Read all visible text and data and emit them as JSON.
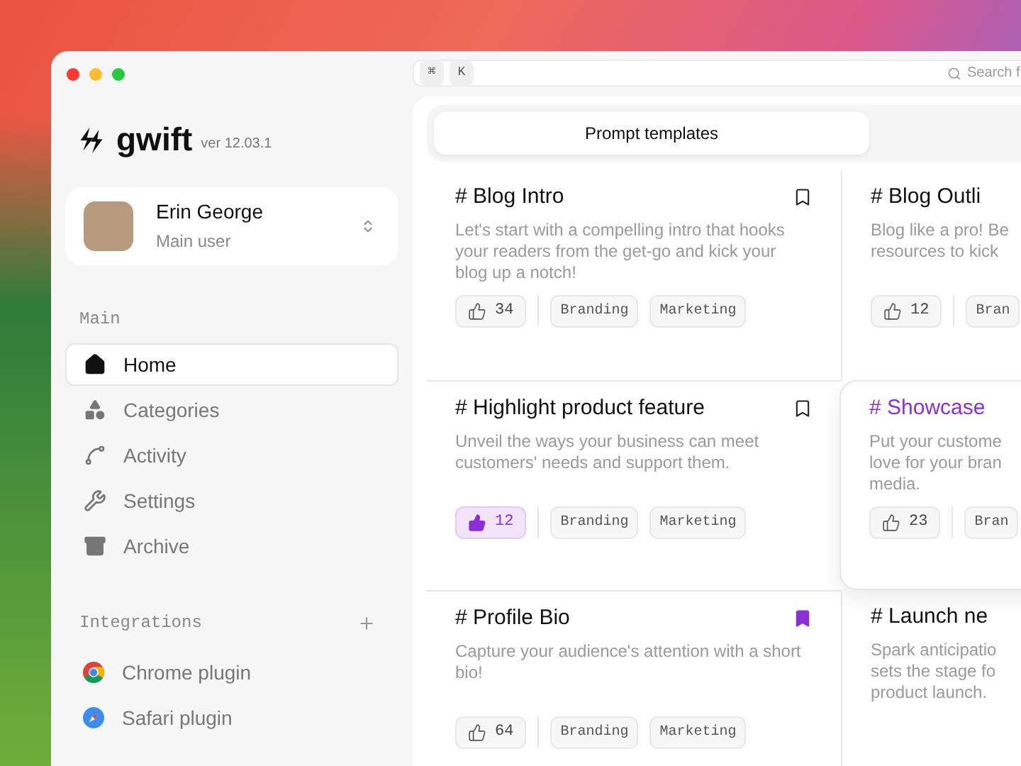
{
  "brand": {
    "name": "gwift",
    "version": "ver 12.03.1"
  },
  "user": {
    "name": "Erin George",
    "role": "Main user"
  },
  "sidebar": {
    "main_heading": "Main",
    "items": [
      {
        "label": "Home",
        "selected": true
      },
      {
        "label": "Categories",
        "selected": false
      },
      {
        "label": "Activity",
        "selected": false
      },
      {
        "label": "Settings",
        "selected": false
      },
      {
        "label": "Archive",
        "selected": false
      }
    ],
    "integrations_heading": "Integrations",
    "integrations": [
      {
        "label": "Chrome plugin"
      },
      {
        "label": "Safari plugin"
      }
    ]
  },
  "toolbar": {
    "keys": [
      "⌘",
      "K"
    ],
    "search": {
      "placeholder": "Search f"
    }
  },
  "tabs": [
    {
      "label": "Prompt templates",
      "selected": true
    }
  ],
  "templates": [
    {
      "prefix": "#",
      "title": "Blog Intro",
      "description_lines": [
        "Let's start with a compelling intro that hooks your readers from the get-go and kick your blog up a notch!"
      ],
      "likes": "34",
      "liked": false,
      "bookmarked": false,
      "tags": [
        "Branding",
        "Marketing"
      ]
    },
    {
      "prefix": "#",
      "title": "Blog Outli",
      "description_lines": [
        "Blog like a pro! Be",
        "resources to kick"
      ],
      "likes": "12",
      "liked": false,
      "tags": [
        "Bran"
      ]
    },
    {
      "prefix": "#",
      "title": "Highlight product feature",
      "description_lines": [
        "Unveil the ways your business can meet customers' needs and support them."
      ],
      "likes": "12",
      "liked": true,
      "bookmarked": false,
      "tags": [
        "Branding",
        "Marketing"
      ]
    },
    {
      "prefix": "#",
      "title": "Showcase",
      "description_lines": [
        "Put your custome",
        "love for your bran",
        "media."
      ],
      "likes": "23",
      "liked": false,
      "hovered": true,
      "tags": [
        "Bran"
      ]
    },
    {
      "prefix": "#",
      "title": "Profile Bio",
      "description_lines": [
        "Capture your audience's attention with a short bio!"
      ],
      "likes": "64",
      "liked": false,
      "bookmarked": true,
      "tags": [
        "Branding",
        "Marketing"
      ]
    },
    {
      "prefix": "#",
      "title": "Launch ne",
      "description_lines": [
        "Spark anticipatio",
        "sets the stage fo",
        "product launch."
      ]
    }
  ]
}
